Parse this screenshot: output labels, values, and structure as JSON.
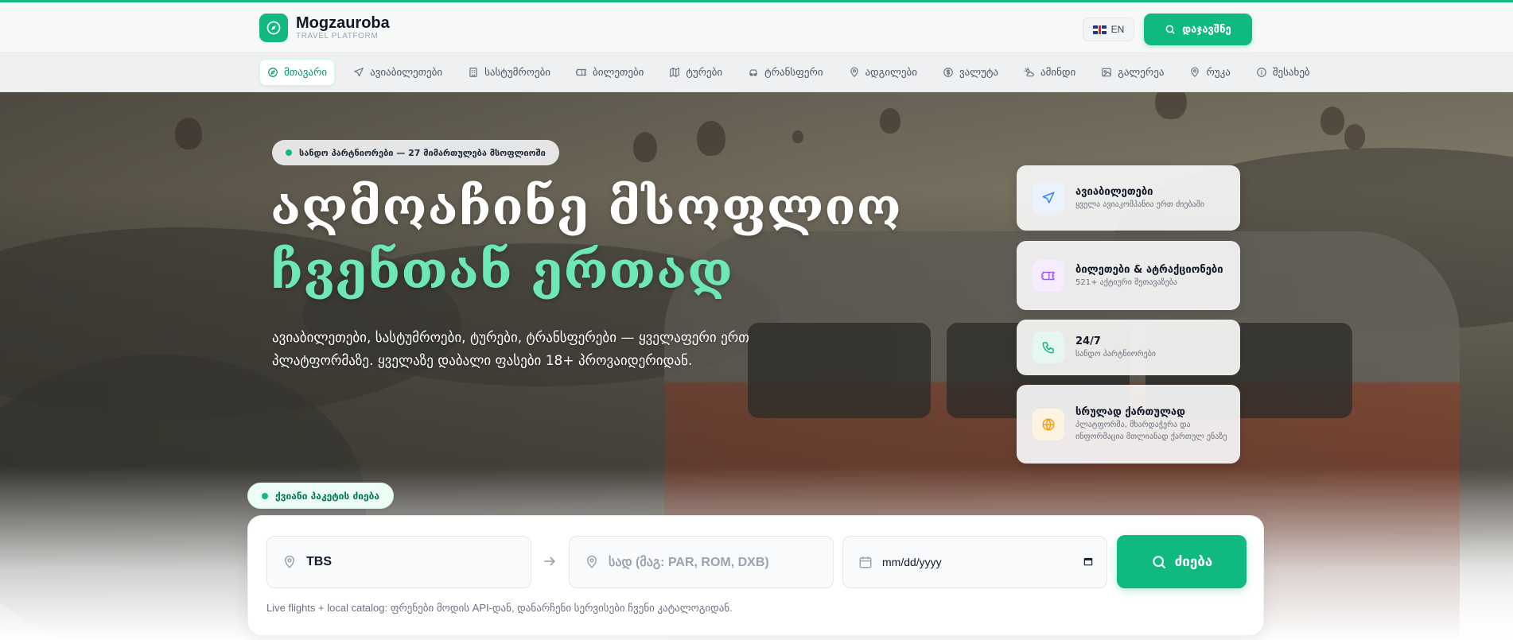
{
  "brand": {
    "name": "Mogzauroba",
    "tagline": "TRAVEL PLATFORM"
  },
  "header": {
    "lang": "EN",
    "search_label": "დაჯავშნე"
  },
  "nav": {
    "items": [
      {
        "label": "მთავარი",
        "icon": "compass-icon",
        "active": true
      },
      {
        "label": "ავიაბილეთები",
        "icon": "plane-icon"
      },
      {
        "label": "სასტუმროები",
        "icon": "building-icon"
      },
      {
        "label": "ბილეთები",
        "icon": "ticket-icon"
      },
      {
        "label": "ტურები",
        "icon": "map-icon"
      },
      {
        "label": "ტრანსფერი",
        "icon": "car-icon"
      },
      {
        "label": "ადგილები",
        "icon": "pin-icon"
      },
      {
        "label": "ვალუტა",
        "icon": "currency-icon"
      },
      {
        "label": "ამინდი",
        "icon": "weather-icon"
      },
      {
        "label": "გალერეა",
        "icon": "image-icon"
      },
      {
        "label": "რუკა",
        "icon": "pin-icon"
      },
      {
        "label": "შესახებ",
        "icon": "info-icon"
      }
    ]
  },
  "hero": {
    "badge": "სანდო პარტნიორები — 27 მიმართულება მსოფლიოში",
    "title_line1": "აღმოაჩინე მსოფლიო",
    "title_line2": "ჩვენთან ერთად",
    "lead": "ავიაბილეთები, სასტუმროები, ტურები, ტრანსფერები — ყველაფერი ერთ პლატფორმაზე. ყველაზე დაბალი ფასები 18+ პროვაიდერიდან."
  },
  "features": [
    {
      "title": "ავიაბილეთები",
      "sub": "ყველა ავიაკომპანია ერთ ძიებაში",
      "icon": "plane-icon",
      "color": "#3b82f6",
      "bg": "#eaf2fe"
    },
    {
      "title": "ბილეთები & ატრაქციონები",
      "sub": "521+ აქტიური შეთავაზება",
      "icon": "ticket-icon",
      "color": "#a855f7",
      "bg": "#f5ecfd"
    },
    {
      "title": "24/7",
      "sub": "სანდო პარტნიორები",
      "icon": "phone-icon",
      "color": "#10b981",
      "bg": "#e6f7f0"
    },
    {
      "title": "სრულად ქართულად",
      "sub": "პლატფორმა, მხარდაჭერა და ინფორმაცია მთლიანად ქართულ ენაზე",
      "icon": "globe-icon",
      "color": "#f59e0b",
      "bg": "#fdf3e1"
    }
  ],
  "search": {
    "quick_label": "ქვიანი პაკეტის ძიება",
    "from_value": "TBS",
    "to_placeholder": "სად (მაგ: PAR, ROM, DXB)",
    "date_placeholder": "mm/dd/yyyy",
    "button": "ძიება",
    "note": "Live flights + local catalog: ფრენები მოდის API-დან, დანარჩენი სერვისები ჩვენი კატალოგიდან."
  },
  "colors": {
    "accent": "#10b981",
    "accent_light": "#6ee7b7"
  }
}
